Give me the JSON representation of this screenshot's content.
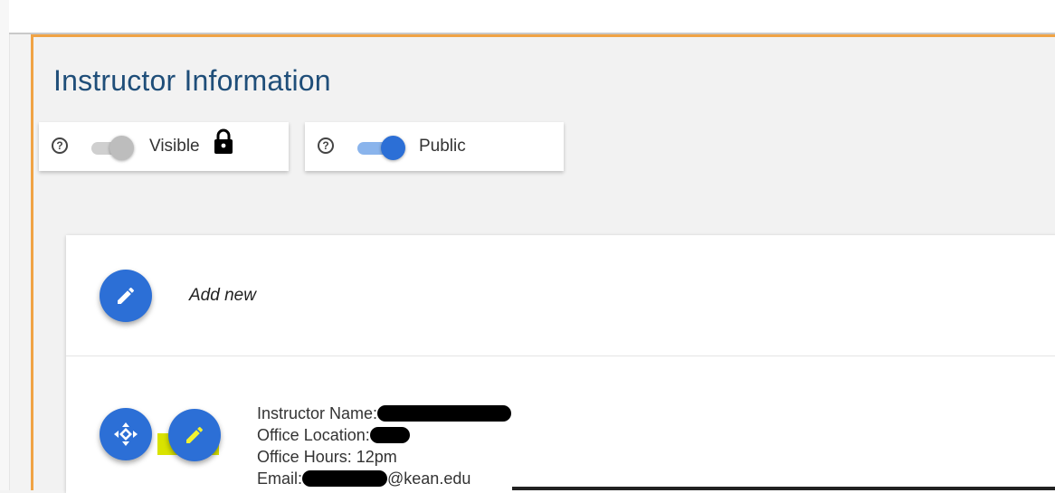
{
  "section": {
    "title": "Instructor Information",
    "accent_color": "#f0a345",
    "title_color": "#1f4e79"
  },
  "toggles": [
    {
      "label": "Visible",
      "state": "off",
      "help_icon": "help-circle-icon",
      "extra_icon": "lock-icon"
    },
    {
      "label": "Public",
      "state": "on",
      "help_icon": "help-circle-icon"
    }
  ],
  "add_row": {
    "label": "Add new",
    "button_icon": "pencil-icon"
  },
  "entry": {
    "name_label": "Instructor Name:",
    "location_label": "Office Location:",
    "hours_text": "Office Hours: 12pm",
    "email_label": "Email:",
    "email_domain": "@kean.edu",
    "move_icon": "move-icon",
    "edit_icon": "pencil-icon"
  },
  "colors": {
    "primary": "#2c6fd6",
    "primary_light": "#8ab4ec",
    "highlight": "#d9e300"
  }
}
